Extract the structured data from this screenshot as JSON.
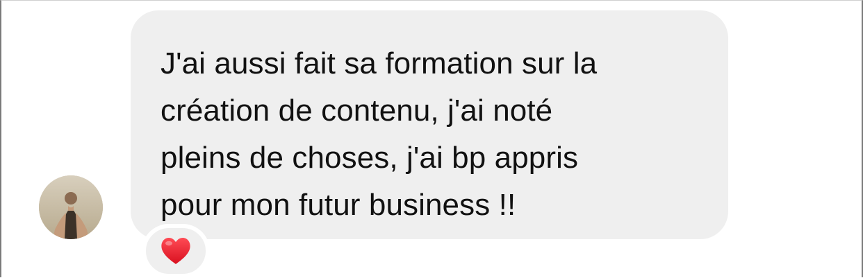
{
  "message": {
    "lines": [
      "J'ai aussi fait sa formation sur la",
      "création de contenu, j'ai noté",
      "pleins de choses, j'ai bp appris",
      "pour mon futur business !!"
    ]
  },
  "reaction": {
    "icon": "red-heart-icon",
    "color": "#e11d2a"
  },
  "colors": {
    "bubble": "#efefef",
    "text": "#111111"
  }
}
